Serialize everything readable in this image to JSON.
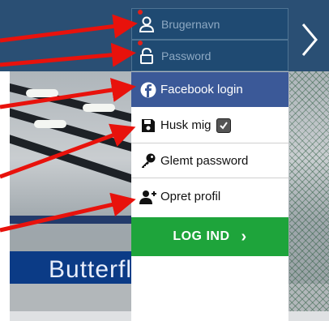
{
  "login_panel": {
    "username_placeholder": "Brugernavn",
    "password_placeholder": "Password",
    "facebook_label": "Facebook login",
    "remember_label": "Husk mig",
    "remember_checked": true,
    "forgot_label": "Glemt password",
    "signup_label": "Opret profil",
    "login_label": "LOG IND",
    "login_chevron": "›"
  },
  "background": {
    "banner_text": "Butterfly"
  },
  "icons": {
    "user": "user-icon",
    "lock": "lock-icon",
    "facebook": "facebook-icon",
    "save": "floppy-disk-icon",
    "key": "key-icon",
    "add_user": "add-user-icon",
    "next": "chevron-right-icon"
  },
  "colors": {
    "panel_dark": "#1f4a72",
    "facebook": "#3b5998",
    "login_green": "#1ea43b",
    "arrow_red": "#e8120c"
  }
}
